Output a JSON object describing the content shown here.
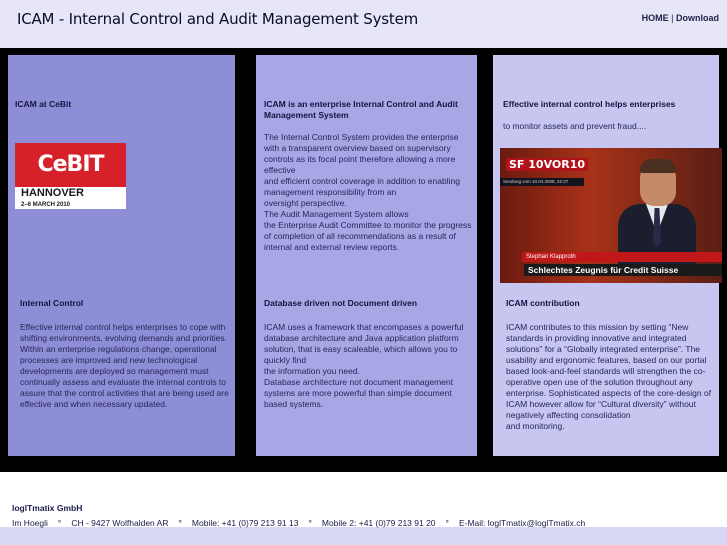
{
  "header": {
    "title": "ICAM - Internal Control and Audit Management System",
    "nav_home": "HOME",
    "nav_sep": "|",
    "nav_download": "Download"
  },
  "col1": {
    "top_heading": "ICAM at CeBit",
    "cebit_logo_text": "CeBIT",
    "cebit_city": "HANNOVER",
    "cebit_dates": "2–6 MARCH 2010",
    "bottom_heading": "Internal Control",
    "bottom_text": "Effective internal control helps enterprises to cope with shifting environments, evolving demands and priorities. Within an enterprise regulations change, operational processes are improved and new technological developments are deployed so management must continually assess and evaluate the internal controls to assure that the control activities that are being used are effective and when necessary updated."
  },
  "col2": {
    "top_heading": "ICAM is an enterprise Internal Control and Audit Management System",
    "top_p1": "The Internal Control System provides the enterprise with a transparent overview based on supervisory controls as its focal point therefore allowing a more effective",
    "top_p2": "and efficient control coverage in addition to enabling management responsibility from an",
    "top_p3": "oversight perspective.",
    "top_p4": "The Audit Management System allows",
    "top_p5": "the Enterprise Audit Committee to monitor the progress of completion of all recommendations as a result of internal and external review reports.",
    "bottom_heading": "Database driven not Document driven",
    "bottom_p1": "ICAM uses a framework that encompases a powerful database architecture and Java application platform solution, that is easy scaleable, which allows you to quickly find",
    "bottom_p2": "the information you need.",
    "bottom_p3": "Database architecture not document management systems are more powerful than simple document based systems."
  },
  "col3": {
    "top_heading": "Effective internal control helps enterprises",
    "top_text": "to monitor assets and prevent fraud....",
    "tv_logo": "SF 10VOR10",
    "tv_bar": "Sendung vom 10.04.2008, 22:27",
    "tv_name": "Stephan Klapproth",
    "tv_caption": "Schlechtes Zeugnis für Credit Suisse",
    "bottom_heading": "ICAM contribution",
    "bottom_p1": "ICAM contributes to this mission by setting “New standards in providing innovative and integrated solutions” for a “Globally integrated enterprise”. The usability and ergonomic features, based on our portal based look-and-feel standards will strengthen the co-operative open use of the solution throughout any enterprise. Sophisticated aspects of the core-design of ICAM however allow for “Cultural diversity” without negatively affecting consolidation",
    "bottom_p2": "and monitoring."
  },
  "footer": {
    "company": "loglTmatix GmbH",
    "address": "Im Hoegli",
    "city": "CH - 9427 Wolfhalden AR",
    "mobile": "Mobile: +41 (0)79 213 91 13",
    "mobile2": "Mobile 2: +41 (0)79 213 91 20",
    "email": "E-Mail: loglTmatix@loglTmatix.ch",
    "bullet": "°"
  },
  "colors": {
    "col1_bg": "#8e8ed6",
    "col2_bg": "#a7a7e6",
    "col3_bg": "#c6c6f0",
    "header_bg": "#e6e6f8",
    "frame": "#000000"
  }
}
